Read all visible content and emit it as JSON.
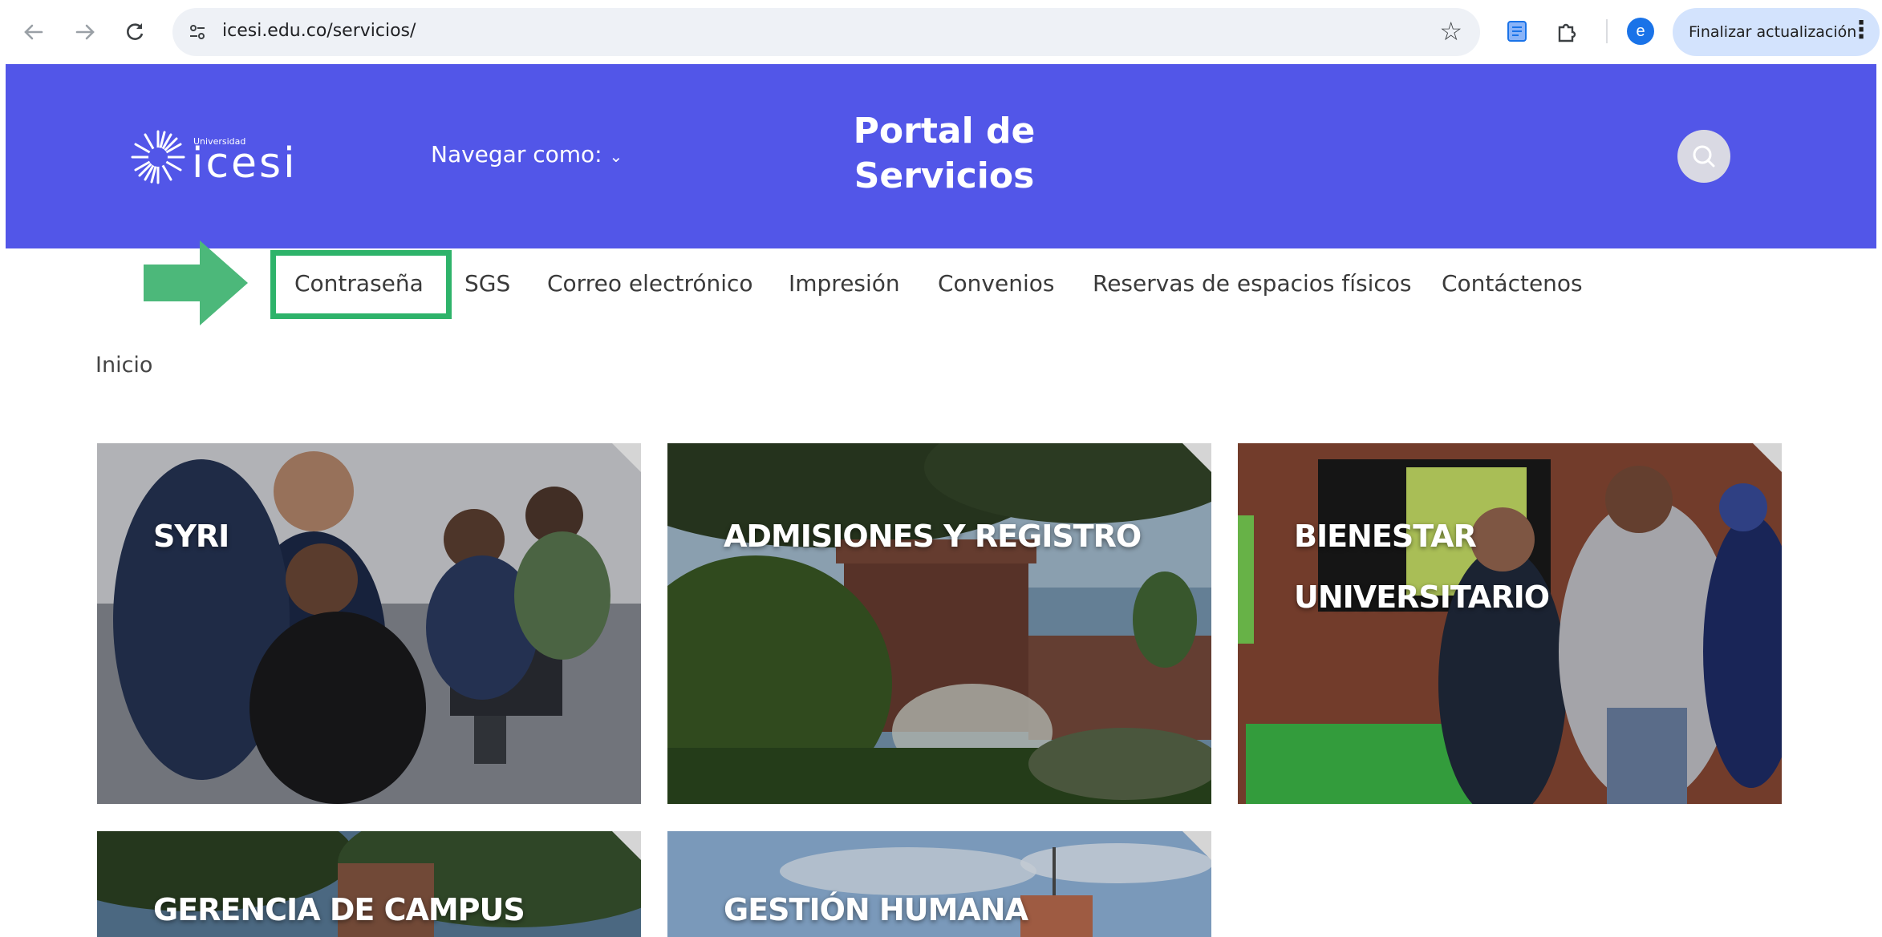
{
  "browser": {
    "url": "icesi.edu.co/servicios/",
    "update_button": "Finalizar actualización",
    "profile_initial": "e"
  },
  "header": {
    "logo_small": "Universidad",
    "logo_name": "icesi",
    "navegar": "Navegar como:",
    "title_line1": "Portal de",
    "title_line2": "Servicios"
  },
  "menu": {
    "items": [
      "Contraseña",
      "SGS",
      "Correo electrónico",
      "Impresión",
      "Convenios",
      "Reservas de espacios físicos",
      "Contáctenos"
    ],
    "highlighted": "Contraseña"
  },
  "breadcrumb": "Inicio",
  "cards": [
    {
      "line1": "SYRI",
      "line2": ""
    },
    {
      "line1": "ADMISIONES Y REGISTRO",
      "line2": ""
    },
    {
      "line1": "BIENESTAR",
      "line2": "UNIVERSITARIO"
    },
    {
      "line1": "GERENCIA DE CAMPUS",
      "line2": ""
    },
    {
      "line1": "GESTIÓN HUMANA",
      "line2": ""
    }
  ],
  "colors": {
    "header_bg": "#5256e8",
    "highlight": "#2eb36a",
    "arrow": "#4cb87a"
  },
  "icons": [
    "back-arrow-icon",
    "forward-arrow-icon",
    "reload-icon",
    "site-settings-icon",
    "star-icon",
    "reading-list-icon",
    "extensions-icon",
    "more-options-icon",
    "search-icon"
  ]
}
